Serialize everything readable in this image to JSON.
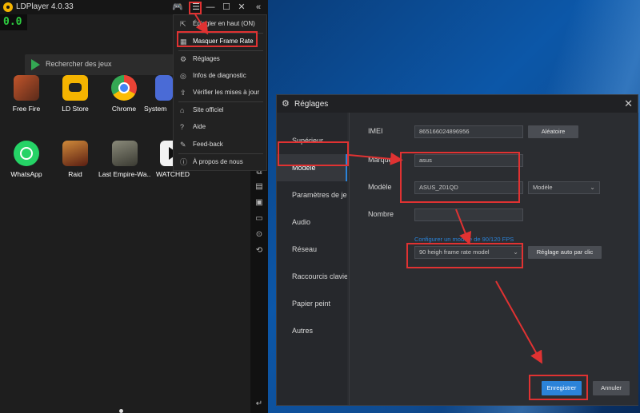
{
  "ldplayer": {
    "title": "LDPlayer 4.0.33",
    "fps": "0.0",
    "search_placeholder": "Rechercher des jeux",
    "apps": [
      {
        "label": "Free Fire",
        "color": "#c2552b"
      },
      {
        "label": "LD Store",
        "color": "#f5b400"
      },
      {
        "label": "Chrome",
        "color": "#e6e6e6"
      },
      {
        "label": "System",
        "color": "#4a6bd6"
      },
      {
        "label": "WhatsApp",
        "color": "#25d366"
      },
      {
        "label": "Raid",
        "color": "#9b4a2a"
      },
      {
        "label": "Last Empire-Wa...",
        "color": "#6b6b5a"
      },
      {
        "label": "WATCHED",
        "color": "#f2f2f2"
      }
    ],
    "menu": [
      {
        "label": "Épingler en haut (ON)",
        "icon": "pin-icon"
      },
      {
        "label": "Masquer Frame Rate",
        "icon": "fps-icon"
      },
      {
        "label": "Réglages",
        "icon": "gear-icon"
      },
      {
        "label": "Infos de diagnostic",
        "icon": "diagnostic-icon"
      },
      {
        "label": "Vérifier les mises à jour",
        "icon": "update-icon"
      },
      {
        "label": "Site officiel",
        "icon": "site-icon"
      },
      {
        "label": "Aide",
        "icon": "help-icon"
      },
      {
        "label": "Feed-back",
        "icon": "feedback-icon"
      },
      {
        "label": "À propos de nous",
        "icon": "info-icon"
      }
    ]
  },
  "settings": {
    "title": "Réglages",
    "nav": [
      "Supérieur",
      "Modèle",
      "Paramètres de jeu",
      "Audio",
      "Réseau",
      "Raccourcis claviers",
      "Papier peint",
      "Autres"
    ],
    "active_nav": "Modèle",
    "imei_label": "IMEI",
    "imei_value": "865166024896956",
    "random_button": "Aléatoire",
    "brand_label": "Marque",
    "brand_value": "asus",
    "model_label": "Modèle",
    "model_value": "ASUS_Z01QD",
    "model_select": "Modèle",
    "number_label": "Nombre",
    "number_value": "",
    "fps_link": "Configurer un modèle de 90/120 FPS",
    "fps_select": "90 heigh frame rate model",
    "auto_button": "Réglage auto par clic",
    "save_button": "Enregistrer",
    "cancel_button": "Annuler"
  },
  "colors": {
    "accent": "#2b83d9",
    "annotation": "#e03232",
    "fps_green": "#2ecc40"
  }
}
